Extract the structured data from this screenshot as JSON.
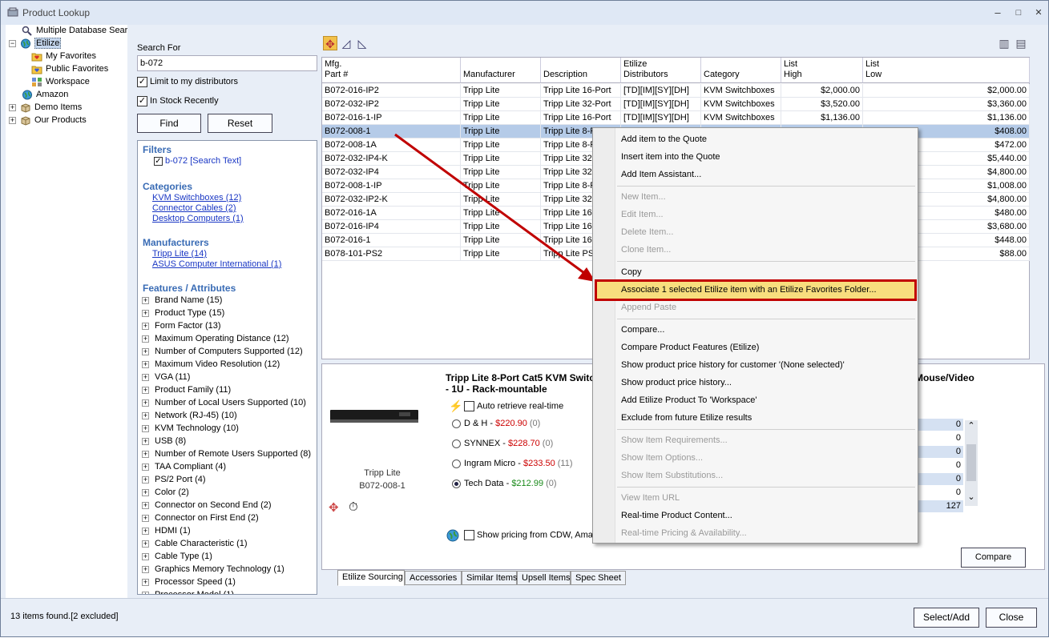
{
  "window": {
    "title": "Product Lookup",
    "minimize": "–",
    "maximize": "□",
    "close": "✕"
  },
  "tree": {
    "items": [
      {
        "label": "Multiple Database Sear",
        "icon": "search-icon"
      },
      {
        "label": "Etilize",
        "icon": "globe-icon",
        "expander": "−"
      },
      {
        "label": "My Favorites",
        "icon": "folder-heart-icon"
      },
      {
        "label": "Public Favorites",
        "icon": "folder-heart-icon"
      },
      {
        "label": "Workspace",
        "icon": "workspace-icon"
      },
      {
        "label": "Amazon",
        "icon": "globe-icon"
      },
      {
        "label": "Demo Items",
        "icon": "box-icon",
        "expander": "+"
      },
      {
        "label": "Our Products",
        "icon": "box-icon",
        "expander": "+"
      }
    ]
  },
  "search": {
    "label": "Search For",
    "value": "b-072",
    "limit_label": "Limit to my distributors",
    "instock_label": "In Stock Recently",
    "find_label": "Find",
    "reset_label": "Reset"
  },
  "facets": {
    "filters_header": "Filters",
    "filter_item": "b-072 [Search Text]",
    "categories_header": "Categories",
    "categories": [
      "KVM Switchboxes (12)",
      "Connector Cables (2)",
      "Desktop Computers (1)"
    ],
    "manufacturers_header": "Manufacturers",
    "manufacturers": [
      "Tripp Lite (14)",
      "ASUS Computer International (1)"
    ],
    "features_header": "Features / Attributes",
    "features": [
      "Brand Name (15)",
      "Product Type (15)",
      "Form Factor (13)",
      "Maximum Operating Distance (12)",
      "Number of Computers Supported (12)",
      "Maximum Video Resolution (12)",
      "VGA (11)",
      "Product Family (11)",
      "Number of Local Users Supported (10)",
      "Network (RJ-45) (10)",
      "KVM Technology (10)",
      "USB (8)",
      "Number of Remote Users Supported (8)",
      "TAA Compliant (4)",
      "PS/2 Port (4)",
      "Color (2)",
      "Connector on Second End (2)",
      "Connector on First End (2)",
      "HDMI (1)",
      "Cable Characteristic (1)",
      "Cable Type (1)",
      "Graphics Memory Technology (1)",
      "Processor Speed (1)",
      "Processor Model (1)"
    ]
  },
  "grid": {
    "headers": [
      {
        "l1": "Mfg.",
        "l2": "Part #"
      },
      {
        "l1": "",
        "l2": "Manufacturer"
      },
      {
        "l1": "",
        "l2": "Description"
      },
      {
        "l1": "Etilize",
        "l2": "Distributors"
      },
      {
        "l1": "",
        "l2": "Category"
      },
      {
        "l1": "List",
        "l2": "High"
      },
      {
        "l1": "List",
        "l2": "Low"
      }
    ],
    "rows": [
      {
        "part": "B072-016-IP2",
        "mfr": "Tripp Lite",
        "desc": "Tripp Lite 16-Port",
        "dist": "[TD][IM][SY][DH]",
        "cat": "KVM Switchboxes",
        "high": "$2,000.00",
        "low": "$2,000.00"
      },
      {
        "part": "B072-032-IP2",
        "mfr": "Tripp Lite",
        "desc": "Tripp Lite 32-Port",
        "dist": "[TD][IM][SY][DH]",
        "cat": "KVM Switchboxes",
        "high": "$3,520.00",
        "low": "$3,360.00"
      },
      {
        "part": "B072-016-1-IP",
        "mfr": "Tripp Lite",
        "desc": "Tripp Lite 16-Port",
        "dist": "[TD][IM][SY][DH]",
        "cat": "KVM Switchboxes",
        "high": "$1,136.00",
        "low": "$1,136.00"
      },
      {
        "part": "B072-008-1",
        "mfr": "Tripp Lite",
        "desc": "Tripp Lite 8-P",
        "dist": "",
        "cat": "",
        "high": "",
        "low": "$408.00",
        "selected": true
      },
      {
        "part": "B072-008-1A",
        "mfr": "Tripp Lite",
        "desc": "Tripp Lite 8-P",
        "dist": "",
        "cat": "",
        "high": "",
        "low": "$472.00"
      },
      {
        "part": "B072-032-IP4-K",
        "mfr": "Tripp Lite",
        "desc": "Tripp Lite 32-",
        "dist": "",
        "cat": "",
        "high": "",
        "low": "$5,440.00"
      },
      {
        "part": "B072-032-IP4",
        "mfr": "Tripp Lite",
        "desc": "Tripp Lite 32-",
        "dist": "",
        "cat": "",
        "high": "",
        "low": "$4,800.00"
      },
      {
        "part": "B072-008-1-IP",
        "mfr": "Tripp Lite",
        "desc": "Tripp Lite 8-P",
        "dist": "",
        "cat": "",
        "high": "",
        "low": "$1,008.00"
      },
      {
        "part": "B072-032-IP2-K",
        "mfr": "Tripp Lite",
        "desc": "Tripp Lite 32-",
        "dist": "",
        "cat": "",
        "high": "",
        "low": "$4,800.00"
      },
      {
        "part": "B072-016-1A",
        "mfr": "Tripp Lite",
        "desc": "Tripp Lite 16-",
        "dist": "",
        "cat": "",
        "high": "",
        "low": "$480.00"
      },
      {
        "part": "B072-016-IP4",
        "mfr": "Tripp Lite",
        "desc": "Tripp Lite 16-",
        "dist": "",
        "cat": "",
        "high": "",
        "low": "$3,680.00"
      },
      {
        "part": "B072-016-1",
        "mfr": "Tripp Lite",
        "desc": "Tripp Lite 16-",
        "dist": "",
        "cat": "",
        "high": "",
        "low": "$448.00"
      },
      {
        "part": "B078-101-PS2",
        "mfr": "Tripp Lite",
        "desc": "Tripp Lite PS2",
        "dist": "",
        "cat": "",
        "high": "",
        "low": "$88.00"
      }
    ]
  },
  "detail": {
    "title_line1": "Tripp Lite 8-Port Cat5 KVM Switc",
    "title_line2": "- 1U - Rack-mountable",
    "title_right": "Mouse/Video",
    "brand": "Tripp Lite",
    "part": "B072-008-1",
    "auto_retrieve": "Auto retrieve real-time",
    "distributors": [
      {
        "name": "D & H",
        "price": "$220.90",
        "qty": "(0)",
        "price_color": "#cc0000"
      },
      {
        "name": "SYNNEX",
        "price": "$228.70",
        "qty": "(0)",
        "price_color": "#cc0000"
      },
      {
        "name": "Ingram Micro",
        "price": "$233.50",
        "qty": "(11)",
        "price_color": "#cc0000"
      },
      {
        "name": "Tech Data",
        "price": "$212.99",
        "qty": "(0)",
        "price_color": "#1a8a1a",
        "selected": true
      }
    ],
    "show_pricing": "Show pricing from CDW, Amaz",
    "qty_values": [
      "0",
      "0",
      "0",
      "0",
      "0",
      "0",
      "127"
    ],
    "compare_label": "Compare"
  },
  "tabs": [
    "Etilize Sourcing",
    "Accessories",
    "Similar Items",
    "Upsell Items",
    "Spec Sheet"
  ],
  "status": {
    "text": "13 items found.[2 excluded]",
    "select_add": "Select/Add",
    "close": "Close"
  },
  "menu": {
    "items": [
      {
        "label": "Add item to the Quote",
        "disabled": false
      },
      {
        "label": "Insert item into the Quote",
        "disabled": false
      },
      {
        "label": "Add Item Assistant...",
        "disabled": false
      },
      {
        "label": "New Item...",
        "disabled": true
      },
      {
        "label": "Edit Item...",
        "disabled": true
      },
      {
        "label": "Delete Item...",
        "disabled": true
      },
      {
        "label": "Clone Item...",
        "disabled": true
      },
      {
        "label": "Copy",
        "disabled": false
      },
      {
        "label": "Associate 1 selected Etilize item with an Etilize Favorites Folder...",
        "disabled": false,
        "highlight": true
      },
      {
        "label": "Append Paste",
        "disabled": true
      },
      {
        "label": "Compare...",
        "disabled": false
      },
      {
        "label": "Compare Product Features (Etilize)",
        "disabled": false
      },
      {
        "label": "Show product price history for customer '(None selected)'",
        "disabled": false
      },
      {
        "label": "Show product price history...",
        "disabled": false
      },
      {
        "label": "Add Etilize Product To 'Workspace'",
        "disabled": false
      },
      {
        "label": "Exclude from future Etilize results",
        "disabled": false
      },
      {
        "label": "Show Item Requirements...",
        "disabled": true
      },
      {
        "label": "Show Item Options...",
        "disabled": true
      },
      {
        "label": "Show Item Substitutions...",
        "disabled": true
      },
      {
        "label": "View Item URL",
        "disabled": true
      },
      {
        "label": "Real-time Product Content...",
        "disabled": false
      },
      {
        "label": "Real-time Pricing & Availability...",
        "disabled": true
      }
    ]
  },
  "colors": {
    "accent_red": "#c00000",
    "highlight": "#f8de7e",
    "selection": "#b5cbe8",
    "link": "#1a37c4"
  }
}
